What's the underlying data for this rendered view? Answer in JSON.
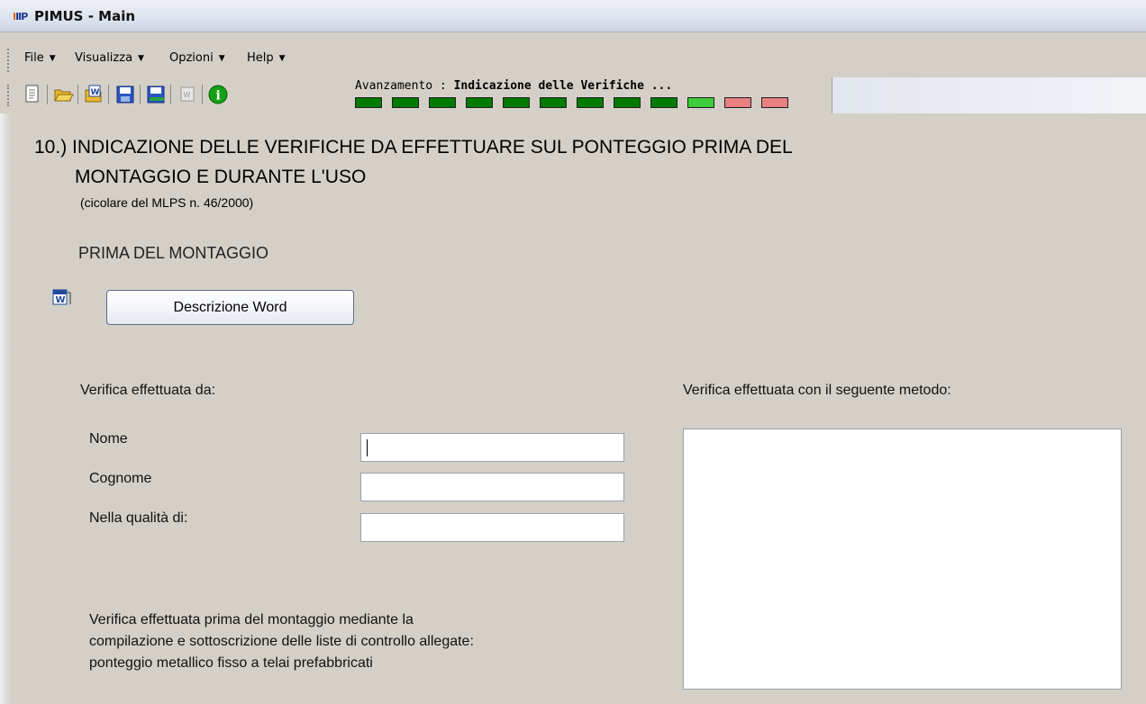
{
  "window": {
    "app_logo": "IIP",
    "title": "PIMUS - Main"
  },
  "menu": [
    {
      "label": "File"
    },
    {
      "label": "Visualizza"
    },
    {
      "label": "Opzioni"
    },
    {
      "label": "Help"
    }
  ],
  "toolbar": {
    "buttons": [
      "new-document-icon",
      "open-folder-icon",
      "word-template-icon",
      "save-icon",
      "save-as-icon",
      "word-export-icon",
      "info-icon"
    ]
  },
  "progress": {
    "label_prefix": "Avanzamento : ",
    "label_step": "Indicazione delle Verifiche ...",
    "steps": [
      "#007a00",
      "#007a00",
      "#007a00",
      "#007a00",
      "#007a00",
      "#007a00",
      "#007a00",
      "#007a00",
      "#007a00",
      "#3ccc3c",
      "#e88080",
      "#e88080"
    ]
  },
  "page": {
    "heading_line1": "10.) INDICAZIONE DELLE VERIFICHE DA EFFETTUARE SUL PONTEGGIO PRIMA DEL",
    "heading_line2": "MONTAGGIO E DURANTE L'USO",
    "subheading": "(cicolare del MLPS n. 46/2000)",
    "section_label": "PRIMA DEL MONTAGGIO",
    "word_button": "Descrizione Word"
  },
  "form": {
    "verified_by_label": "Verifica effettuata da:",
    "method_label": "Verifica effettuata con il seguente metodo:",
    "nome_label": "Nome",
    "nome_value": "",
    "cognome_label": "Cognome",
    "cognome_value": "",
    "qualita_label": "Nella qualità di:",
    "qualita_value": "",
    "method_value": "",
    "note_line1": "Verifica effettuata prima del montaggio mediante la",
    "note_line2": "compilazione e sottoscrizione delle liste di controllo allegate:",
    "note_line3": "ponteggio metallico fisso a telai prefabbricati"
  }
}
